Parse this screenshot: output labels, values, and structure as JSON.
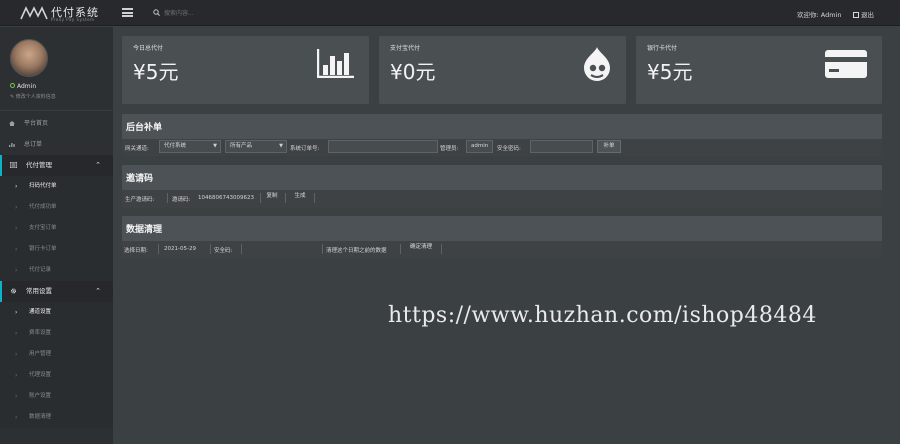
{
  "header": {
    "logo_title": "代付系统",
    "logo_subtitle": "Proxy Pay System",
    "search_placeholder": "搜索内容...",
    "welcome": "欢迎你: Admin",
    "logout": "退出"
  },
  "profile": {
    "status": "Admin",
    "edit": "修改个人资料信息"
  },
  "sidebar": {
    "items": [
      {
        "label": "平台首页",
        "icon": "home-icon"
      },
      {
        "label": "总订单",
        "icon": "chart-icon"
      }
    ],
    "groups": [
      {
        "label": "代付管理",
        "icon": "list-icon",
        "children": [
          "扫码代付单",
          "代付成功单",
          "支付宝订单",
          "银行卡订单",
          "代付记录"
        ]
      },
      {
        "label": "常用设置",
        "icon": "gear-icon",
        "children": [
          "通道设置",
          "费率设置",
          "用户管理",
          "代理设置",
          "账户设置",
          "数据清理"
        ]
      }
    ]
  },
  "cards": [
    {
      "label": "今日总代付",
      "value": "¥5元",
      "icon": "bar-chart-icon"
    },
    {
      "label": "支付宝代付",
      "value": "¥0元",
      "icon": "drupal-icon"
    },
    {
      "label": "银行卡代付",
      "value": "¥5元",
      "icon": "credit-card-icon"
    }
  ],
  "supplement": {
    "title": "后台补单",
    "channel_label": "网关通道:",
    "channel_value": "代付系统",
    "product_value": "所有产品",
    "order_label": "系统订单号:",
    "operator_label": "管理员:",
    "operator_value": "admin",
    "password_label": "安全密码:",
    "submit": "补单"
  },
  "invite": {
    "title": "邀请码",
    "gen_label": "生产邀请码:",
    "code_label": "邀请码:",
    "code_value": "1046806743009623",
    "copy": "复制",
    "generate": "生成"
  },
  "cleanup": {
    "title": "数据清理",
    "date_label": "选择日期:",
    "date_value": "2021-05-29",
    "pwd_label": "安全码:",
    "note": "清理这个日期之前的数据",
    "confirm": "确定清理"
  },
  "watermark": "https://www.huzhan.com/ishop48484",
  "colors": {
    "accent": "#0db1c8",
    "online": "#7ac943"
  }
}
